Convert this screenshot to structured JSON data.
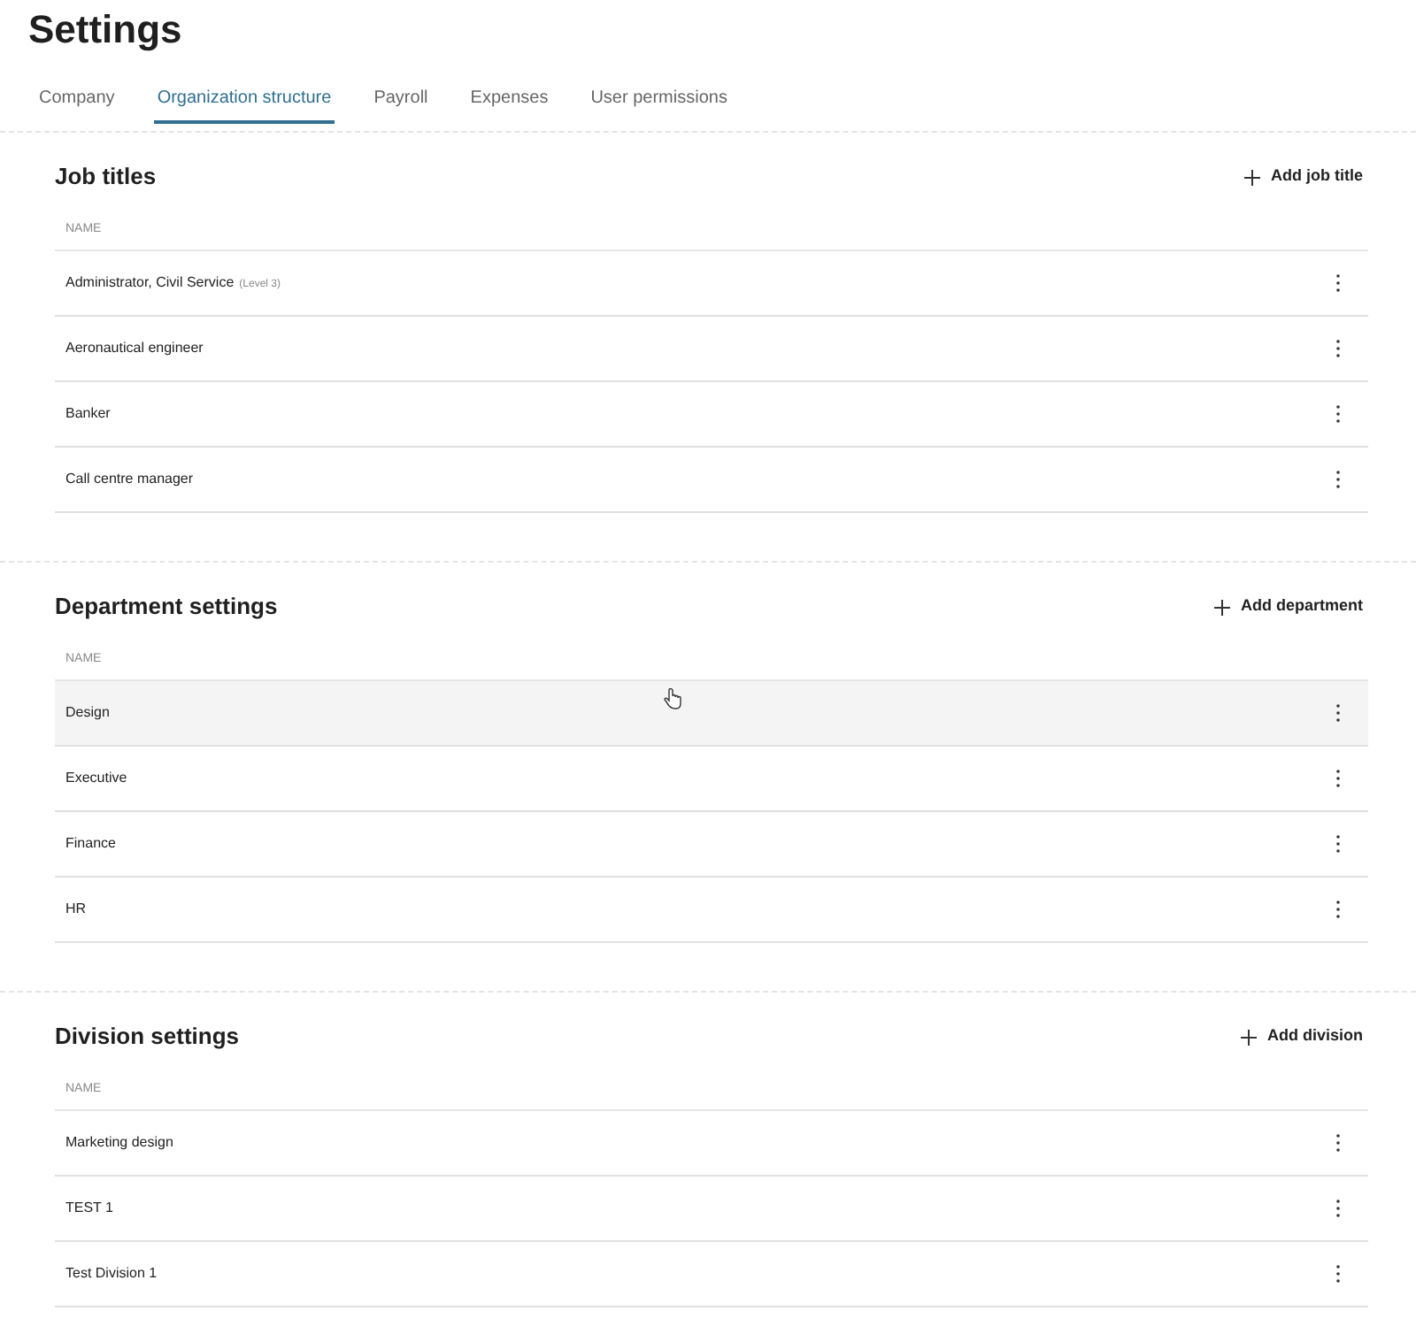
{
  "page_title": "Settings",
  "tabs": [
    {
      "label": "Company",
      "selected": false
    },
    {
      "label": "Organization structure",
      "selected": true
    },
    {
      "label": "Payroll",
      "selected": false
    },
    {
      "label": "Expenses",
      "selected": false
    },
    {
      "label": "User permissions",
      "selected": false
    }
  ],
  "sections": [
    {
      "title": "Job titles",
      "add_button": "Add job title",
      "column": "NAME",
      "rows": [
        {
          "name": "Administrator, Civil Service",
          "note": "(Level 3)",
          "highlighted": false
        },
        {
          "name": "Aeronautical engineer",
          "highlighted": false
        },
        {
          "name": "Banker",
          "highlighted": false
        },
        {
          "name": "Call centre manager",
          "highlighted": false
        }
      ]
    },
    {
      "title": "Department settings",
      "add_button": "Add department",
      "column": "NAME",
      "rows": [
        {
          "name": "Design",
          "highlighted": true
        },
        {
          "name": "Executive",
          "highlighted": false
        },
        {
          "name": "Finance",
          "highlighted": false
        },
        {
          "name": "HR",
          "highlighted": false
        }
      ]
    },
    {
      "title": "Division settings",
      "add_button": "Add division",
      "column": "NAME",
      "rows": [
        {
          "name": "Marketing design",
          "highlighted": false
        },
        {
          "name": "TEST 1",
          "highlighted": false
        },
        {
          "name": "Test Division 1",
          "highlighted": false
        }
      ]
    }
  ]
}
